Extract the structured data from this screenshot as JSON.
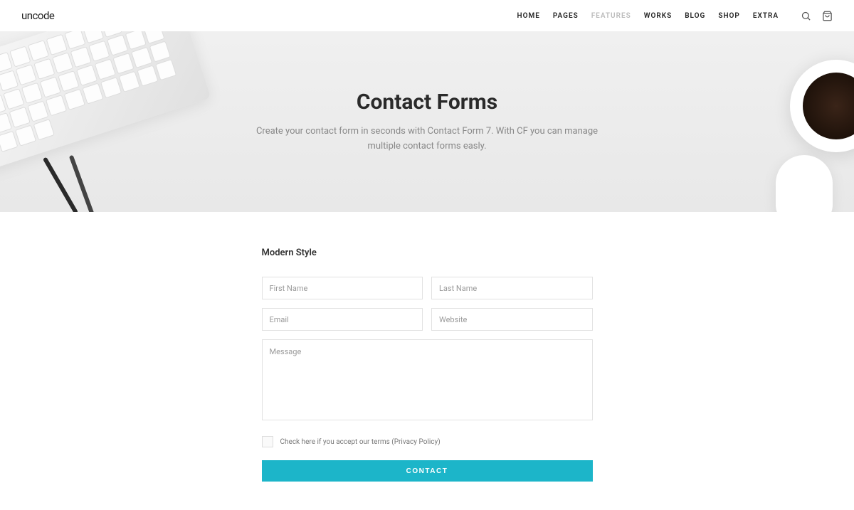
{
  "header": {
    "logo": "uncode",
    "nav": [
      {
        "label": "HOME",
        "active": false
      },
      {
        "label": "PAGES",
        "active": false
      },
      {
        "label": "FEATURES",
        "active": true
      },
      {
        "label": "WORKS",
        "active": false
      },
      {
        "label": "BLOG",
        "active": false
      },
      {
        "label": "SHOP",
        "active": false
      },
      {
        "label": "EXTRA",
        "active": false
      }
    ]
  },
  "hero": {
    "title": "Contact Forms",
    "subtitle": "Create your contact form in seconds with Contact Form 7. With CF you can manage multiple contact forms easly."
  },
  "form": {
    "section_title": "Modern Style",
    "first_name_placeholder": "First Name",
    "last_name_placeholder": "Last Name",
    "email_placeholder": "Email",
    "website_placeholder": "Website",
    "message_placeholder": "Message",
    "checkbox_label": "Check here if you accept our terms (Privacy Policy)",
    "submit_label": "CONTACT"
  }
}
